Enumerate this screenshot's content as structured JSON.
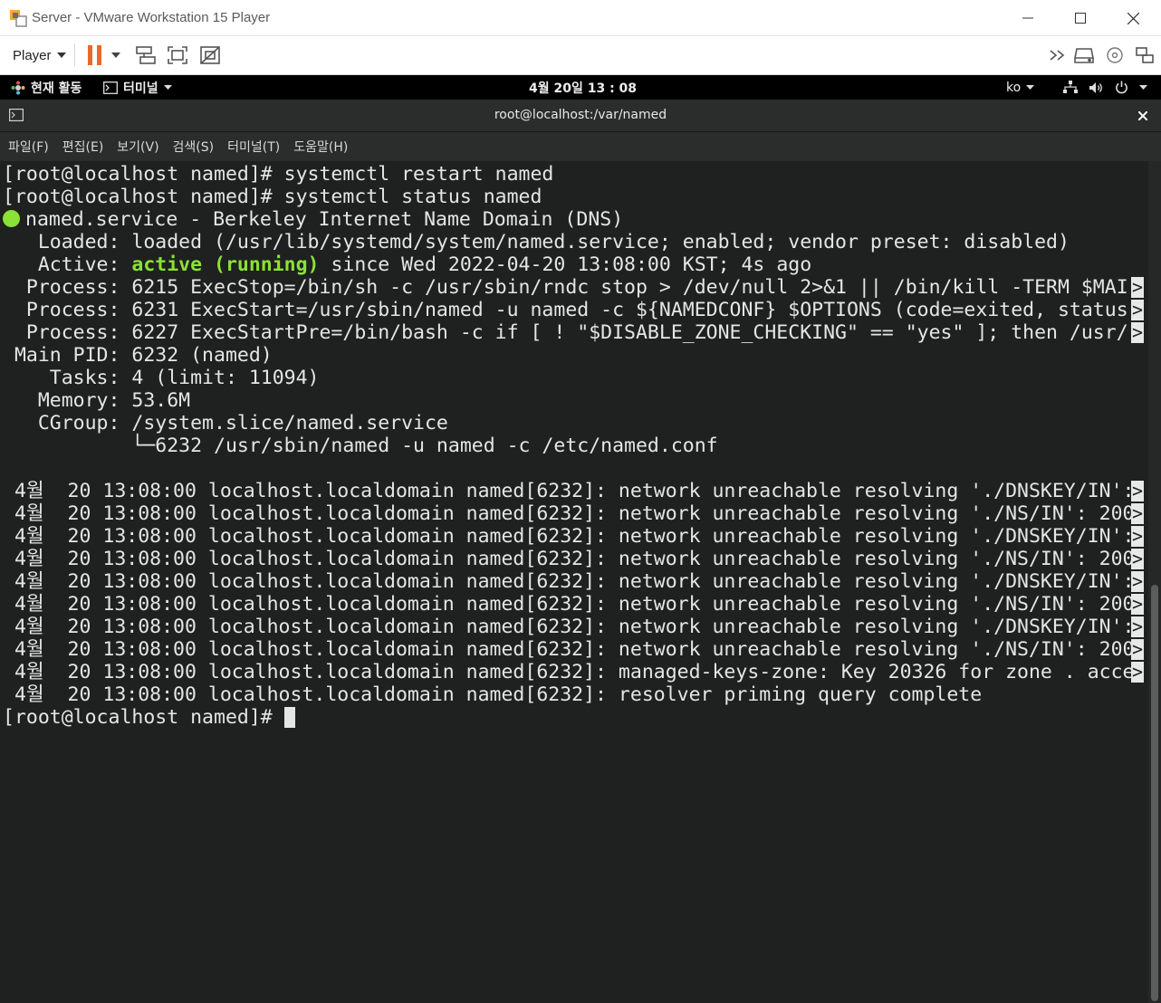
{
  "window": {
    "title": "Server - VMware Workstation 15 Player"
  },
  "toolbar": {
    "player_label": "Player"
  },
  "gnome": {
    "activities": "현재 활동",
    "app_menu": "터미널",
    "clock": "4월 20일  13 : 08",
    "input_method": "ko"
  },
  "terminal": {
    "title": "root@localhost:/var/named",
    "menu": [
      "파일(F)",
      "편집(E)",
      "보기(V)",
      "검색(S)",
      "터미널(T)",
      "도움말(H)"
    ],
    "lines": [
      {
        "text": "[root@localhost named]# systemctl restart named"
      },
      {
        "text": "[root@localhost named]# systemctl status named"
      },
      {
        "dot": true,
        "text": "named.service - Berkeley Internet Name Domain (DNS)"
      },
      {
        "text": "   Loaded: loaded (/usr/lib/systemd/system/named.service; enabled; vendor preset: disabled)"
      },
      {
        "prefix": "   Active: ",
        "highlight": "active (running)",
        "text": " since Wed 2022-04-20 13:08:00 KST; 4s ago"
      },
      {
        "text": "  Process: 6215 ExecStop=/bin/sh -c /usr/sbin/rndc stop > /dev/null 2>&1 || /bin/kill -TERM $MAI",
        "trunc": true
      },
      {
        "text": "  Process: 6231 ExecStart=/usr/sbin/named -u named -c ${NAMEDCONF} $OPTIONS (code=exited, status",
        "trunc": true
      },
      {
        "text": "  Process: 6227 ExecStartPre=/bin/bash -c if [ ! \"$DISABLE_ZONE_CHECKING\" == \"yes\" ]; then /usr/",
        "trunc": true
      },
      {
        "text": " Main PID: 6232 (named)"
      },
      {
        "text": "    Tasks: 4 (limit: 11094)"
      },
      {
        "text": "   Memory: 53.6M"
      },
      {
        "text": "   CGroup: /system.slice/named.service"
      },
      {
        "text": "           └─6232 /usr/sbin/named -u named -c /etc/named.conf"
      },
      {
        "text": ""
      },
      {
        "text": " 4월  20 13:08:00 localhost.localdomain named[6232]: network unreachable resolving './DNSKEY/IN':",
        "trunc": true
      },
      {
        "text": " 4월  20 13:08:00 localhost.localdomain named[6232]: network unreachable resolving './NS/IN': 200",
        "trunc": true
      },
      {
        "text": " 4월  20 13:08:00 localhost.localdomain named[6232]: network unreachable resolving './DNSKEY/IN':",
        "trunc": true
      },
      {
        "text": " 4월  20 13:08:00 localhost.localdomain named[6232]: network unreachable resolving './NS/IN': 200",
        "trunc": true
      },
      {
        "text": " 4월  20 13:08:00 localhost.localdomain named[6232]: network unreachable resolving './DNSKEY/IN':",
        "trunc": true
      },
      {
        "text": " 4월  20 13:08:00 localhost.localdomain named[6232]: network unreachable resolving './NS/IN': 200",
        "trunc": true
      },
      {
        "text": " 4월  20 13:08:00 localhost.localdomain named[6232]: network unreachable resolving './DNSKEY/IN':",
        "trunc": true
      },
      {
        "text": " 4월  20 13:08:00 localhost.localdomain named[6232]: network unreachable resolving './NS/IN': 200",
        "trunc": true
      },
      {
        "text": " 4월  20 13:08:00 localhost.localdomain named[6232]: managed-keys-zone: Key 20326 for zone . acce",
        "trunc": true
      },
      {
        "text": " 4월  20 13:08:00 localhost.localdomain named[6232]: resolver priming query complete"
      },
      {
        "text": "[root@localhost named]# ",
        "cursor": true
      }
    ],
    "truncation_marker": ">"
  },
  "colors": {
    "active_green": "#8ae234",
    "pause_orange": "#e8692e"
  }
}
